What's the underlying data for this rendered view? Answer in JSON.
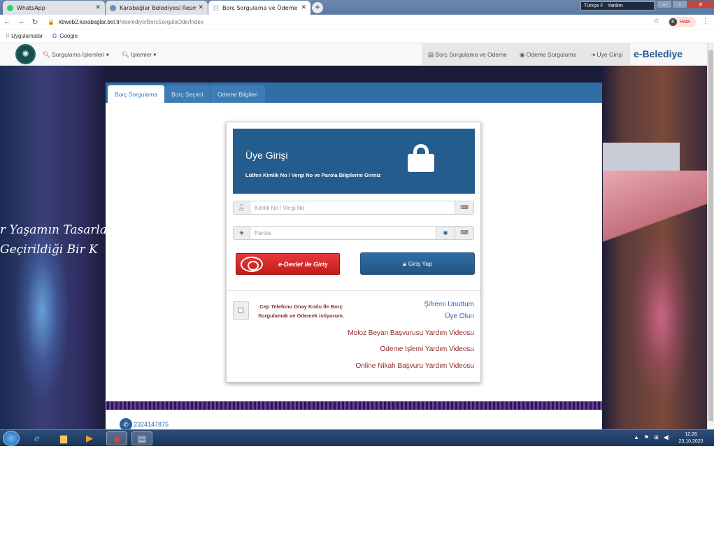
{
  "browser": {
    "tabs": [
      {
        "title": "WhatsApp",
        "icon": "whatsapp-icon",
        "active": false
      },
      {
        "title": "Karabağlar Belediyesi Resmi Web",
        "icon": "site-icon",
        "active": false
      },
      {
        "title": "Borç Sorgulama ve Ödeme",
        "icon": "page-icon",
        "active": true
      }
    ],
    "new_tab": "+",
    "lang_bar": {
      "lang": "Türkçe F",
      "help": "Yardım"
    },
    "url_host": "kbweb2.karabaglar.bel.tr",
    "url_path": "/ebelediye/BorcSorgulaOde/Index",
    "profile_initial": "K",
    "profile_status": "Hata",
    "bookmarks": [
      {
        "label": "Uygulamalar",
        "icon": "apps-grid-icon"
      },
      {
        "label": "Google",
        "icon": "google-icon"
      }
    ]
  },
  "site_nav": {
    "left": [
      {
        "label": "Sorgulama İşlemleri",
        "icon": "search-icon"
      },
      {
        "label": "İşlemler",
        "icon": "search-icon"
      }
    ],
    "right": [
      {
        "label": "Borç Sorgulama ve Odeme",
        "icon": "card-icon"
      },
      {
        "label": "Odeme Sorgulama",
        "icon": "eye-icon"
      },
      {
        "label": "Uye Girişi",
        "icon": "login-icon"
      }
    ],
    "brand": "e-Belediye"
  },
  "background": {
    "tagline_1": "r Yaşamın Tasarlan",
    "tagline_2": "Geçirildiği Bir K"
  },
  "panel_tabs": [
    "Borç Sorgulama",
    "Borç Seçimi",
    "Odeme Bilgileri"
  ],
  "login": {
    "title": "Üye Girişi",
    "subtitle": "Lütfen Kimlik No / Vergi No ve Parola Bilgilerini Giriniz",
    "id_placeholder": "Kimlik No / Vergi No",
    "password_placeholder": "Parola",
    "edevlet_label": "e-Devlet ile Giriş",
    "login_label": "Giriş Yap",
    "sms_text": "Cep Telefonu Onay Kodu İle Borç Sorgulamak ve Odemek istiyorum.",
    "forgot_password": "Şifremi Unuttum",
    "register": "Üye Olun",
    "video_links": [
      "Moloz Beyan Başvurusu Yardım Videosu",
      "Ödeme İşlemi Yardım Videosu",
      "Online Nikah Başvuru Yardım Videosu"
    ]
  },
  "footer": {
    "phone": "2324147875"
  },
  "taskbar": {
    "apps": [
      "internet-explorer-icon",
      "folder-icon",
      "media-player-icon",
      "chrome-icon",
      "word-icon"
    ],
    "time": "12:26",
    "date": "23.10.2020"
  }
}
